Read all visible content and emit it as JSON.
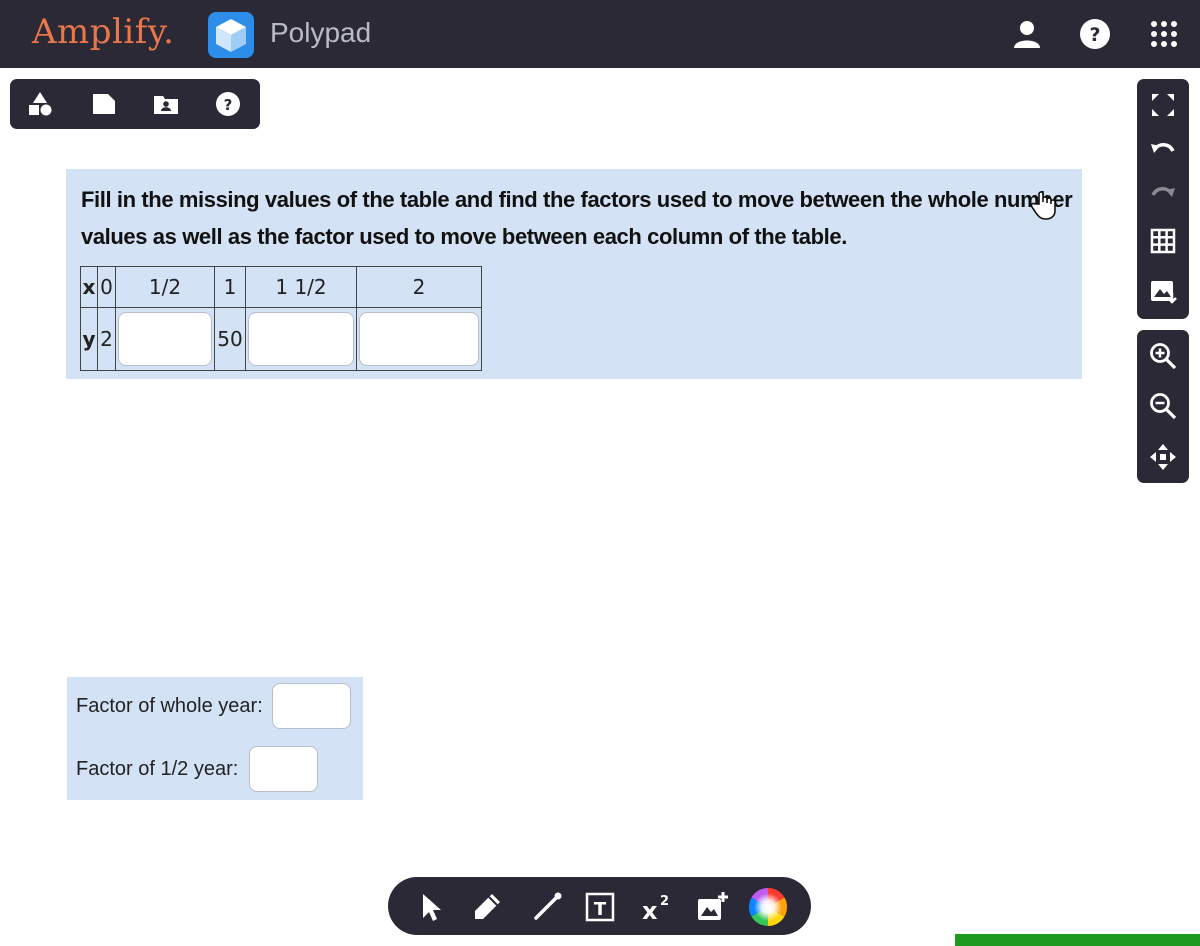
{
  "header": {
    "brand": "Amplify.",
    "app_name": "Polypad",
    "icons": [
      "user-icon",
      "help-icon",
      "apps-grid-icon"
    ]
  },
  "left_toolbar": {
    "icons": [
      "shapes-icon",
      "file-icon",
      "folder-icon",
      "help-icon"
    ]
  },
  "right_toolbar": {
    "groups": [
      [
        "fullscreen-icon",
        "undo-icon",
        "redo-icon",
        "grid-icon",
        "export-image-icon"
      ],
      [
        "zoom-in-icon",
        "zoom-out-icon",
        "pan-icon"
      ]
    ]
  },
  "task": {
    "instructions": "Fill in the missing values of the table and find the factors used to move between the whole number values as well as the factor used to move between each column of the table.",
    "table": {
      "x_label": "x",
      "y_label": "y",
      "x_values": [
        "0",
        "1/2",
        "1",
        "1 1/2",
        "2"
      ],
      "y_values": [
        "2",
        "",
        "50",
        "",
        ""
      ]
    }
  },
  "factors": {
    "whole_year_label": "Factor of whole year:",
    "whole_year_value": "",
    "half_year_label": "Factor of 1/2 year:",
    "half_year_value": ""
  },
  "bottom_toolbar": {
    "icons": [
      "pointer-icon",
      "pen-icon",
      "line-icon",
      "text-box-icon",
      "equation-icon",
      "add-image-icon",
      "color-wheel-icon"
    ],
    "equation_glyph": "x",
    "equation_exponent": "2",
    "text_glyph": "T"
  },
  "colors": {
    "dark": "#2b2935",
    "panel": "#d3e2f4",
    "brand": "#e9774a",
    "polypad_blue": "#2c8ee8",
    "progress": "#1f9a1f"
  }
}
